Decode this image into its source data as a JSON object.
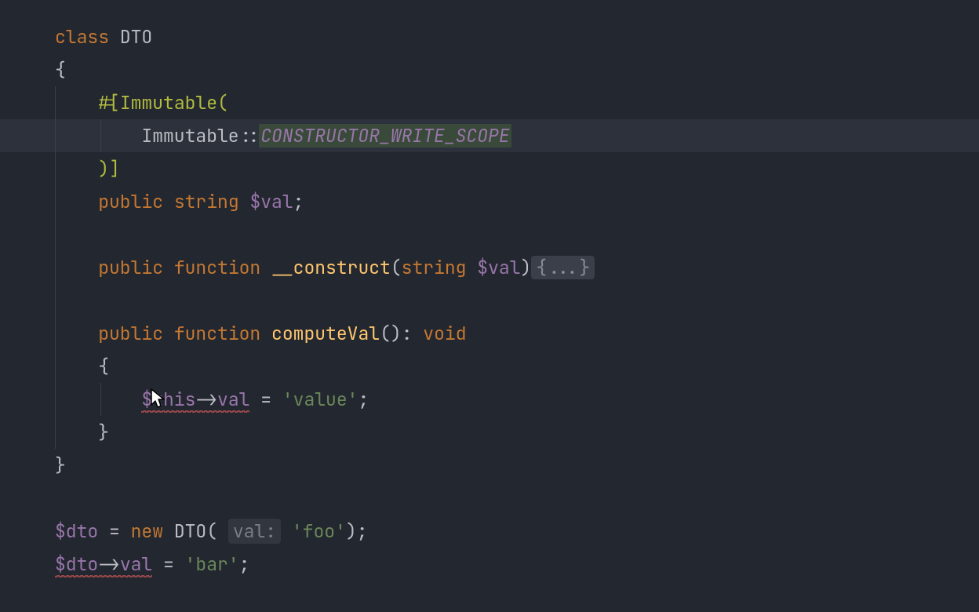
{
  "code": {
    "line1_class": "class",
    "line1_name": "DTO",
    "brace_open": "{",
    "brace_close": "}",
    "attr_open": "#[",
    "attr_name": "Immutable",
    "attr_paren_open": "(",
    "attr_ref": "Immutable",
    "dcolon": "::",
    "attr_const": "CONSTRUCTOR_WRITE_SCOPE",
    "attr_paren_close": ")",
    "attr_close": "]",
    "kw_public": "public",
    "kw_string": "string",
    "var_val": "$val",
    "semi": ";",
    "kw_function": "function",
    "fn_construct": "__construct",
    "paren_open": "(",
    "paren_close": ")",
    "fn_construct_param_type": "string",
    "fn_construct_param": "$val",
    "fold_body": "{...}",
    "fn_compute": "computeVal",
    "ret_colon": ": ",
    "kw_void": "void",
    "this": "$this",
    "arrow": "->",
    "prop_val": "val",
    "assign": " = ",
    "str_value": "'value'",
    "var_dto": "$dto",
    "kw_new": "new",
    "call_name": "DTO",
    "hint_val": "val:",
    "str_foo": "'foo'",
    "str_bar": "'bar'"
  },
  "cursor": {
    "visible": true
  }
}
